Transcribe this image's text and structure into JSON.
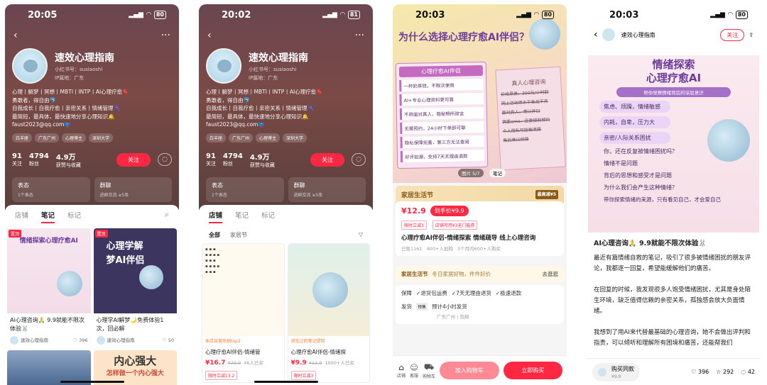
{
  "screens": [
    {
      "time": "20:05",
      "batt": "80"
    },
    {
      "time": "20:02",
      "batt": "81"
    },
    {
      "time": "20:03",
      "batt": "80"
    },
    {
      "time": "20:03",
      "batt": "80"
    }
  ],
  "profile": {
    "name": "速效心理指南",
    "id": "小红书号：susiaoshi",
    "ip": "IP属地：广东",
    "bio": [
      "心理丨解梦丨冥想丨MBTI丨INTP丨AI心理疗愈🫀",
      "勇敢者，得自由🐬",
      "自我成长丨自我疗愈丨亲密关系丨情绪管理🌂",
      "最简短，最具体，最快速地分享心理知识🔔",
      "faust2023@qq.com📪"
    ],
    "tags": [
      "白羊座",
      "广东广州",
      "心理博主",
      "深圳大学"
    ],
    "follows": "91",
    "follows_label": "关注",
    "fans": "4794",
    "fans_label": "粉丝",
    "likes": "4.9万",
    "likes_label": "获赞与收藏",
    "follow_btn": "关注",
    "card1": "表态",
    "card1_sub": "1个表态",
    "card2": "群聊",
    "card2_sub": "进群交流 ≥5条"
  },
  "tabs": {
    "shop": "店铺",
    "notes": "笔记",
    "fav": "标记"
  },
  "notes": [
    {
      "title": "Ai心理咨询🙏 9.9就能不限次体验🐰",
      "author": "速效心理指南",
      "likes": "396",
      "thumb_title": "情绪探索心理疗愈AI",
      "badge": "置顶"
    },
    {
      "title": "心理学AI解梦🌙免费体验1次，回必解",
      "author": "速效心理指南",
      "likes": "50",
      "thumb_title": "心理学解梦AI伴侣",
      "badge": "置顶"
    },
    {
      "thumb_title": "内心强大",
      "thumb_sub": "怎样做一个内心强大"
    }
  ],
  "shop": {
    "filter_all": "全部",
    "filter_home": "家居节",
    "p1_tag": "本店自营热销top2",
    "p1_title": "心理疗愈AI伴侣-情绪管",
    "p1_price": "¥16.7",
    "p1_old": "¥29.9",
    "p1_sold": "46人已买",
    "p1_coupon": "限时立减13.2",
    "p2_tag": "浏览过的笔记提到",
    "p2_title": "心理疗愈AI伴侣-情绪探",
    "p2_price": "¥9.9",
    "p2_old": "¥12.9",
    "p2_sold": "1000+人已买",
    "p2_coupon": "限时立减3"
  },
  "detail": {
    "headline": "为什么选择心理疗愈AI伴侣？",
    "left_title": "心理疗愈AI伴侣",
    "left_rows": [
      "一杯奶茶钱，不限次使用",
      "AI+专业心理资料更可靠",
      "不用面对真人，隐秘畅所欲言",
      "无需预约，24小时下单即可聊",
      "隐私保障完善，第三方无法查阅",
      "好评如潮，支持7天无理由退款"
    ],
    "right_title": "真人心理咨询",
    "right_rows": [
      "价格昂贵，300元/小时起",
      "网上咨询师水平鱼龙不齐",
      "面对真人，难以开口",
      "需要emo，还要提前预约",
      "个人隐私可能被泄漏",
      "售后难以保障"
    ],
    "page": "图片 5/7",
    "note_tab": "笔记",
    "fest": "家居生活节",
    "fest_sub": "最高减¥5",
    "price": "¥12.9",
    "price_after": "到手价¥9.9",
    "coupon1": "限时立减3",
    "coupon2": "店铺可用¥3无门槛券",
    "ptitle": "心理疗愈AI伴侣-情绪探索 情绪疏导 线上心理咨询",
    "sold": "已售1161",
    "sold2": "400+人加购",
    "sold3": "3个月内600+人购买",
    "bar_title": "家居生活节",
    "bar_text": "冬日家居好物，件件好价",
    "bar_go": "去逛逛",
    "guarantee": "保障",
    "g1": "退货包运费",
    "g2": "7天无理由退货",
    "g3": "极速退款",
    "ship": "发货",
    "ship_tag": "预售",
    "ship_text": "预计4小时发货",
    "ship_loc": "广东广州",
    "ship_free": "包邮",
    "b_shop": "店铺",
    "b_cs": "客服",
    "b_cart": "购物车",
    "add_cart": "加入购物车",
    "buy": "立即购买"
  },
  "post": {
    "author": "速效心理指南",
    "follow": "关注",
    "img_title": "情绪探索\n心理疗愈AI",
    "img_tag": "帮你觉察情绪背后的深层意识",
    "pills": [
      "焦虑、烦躁，情绪敏感",
      "内耗，自卑，压力大",
      "亲密/人际关系困扰"
    ],
    "lines": [
      "你，还在反复被情绪困扰吗？",
      "情绪不是问题",
      "背后的思想和感受才是问题",
      "为什么我们会产生这种情绪？",
      "带你探索情绪的来源，只有看见自己，才会爱自己"
    ],
    "title": "AI心理咨询🙏 9.9就能不限次体验🐰",
    "p1": "最近有篇情绪自救的笔记，吸引了很多被情绪困扰的朋友评论，我都逐一回复，希望能缓解他们的痛苦。",
    "p2": "在回复的时候，我发现很多人饱受情绪困扰，尤其是身处陌生环境，缺乏值得信赖的亲密关系，孤独感会放大负面情绪。",
    "p3": "我想到了用AI来代替最基础的心理咨询，她不会做出评判和指责，可以倾听和理解所有困境和痛苦，还能帮我们",
    "buy_label": "购买同款",
    "buy_price": "¥9.9",
    "likes": "396",
    "stars": "292",
    "comments": "42"
  }
}
